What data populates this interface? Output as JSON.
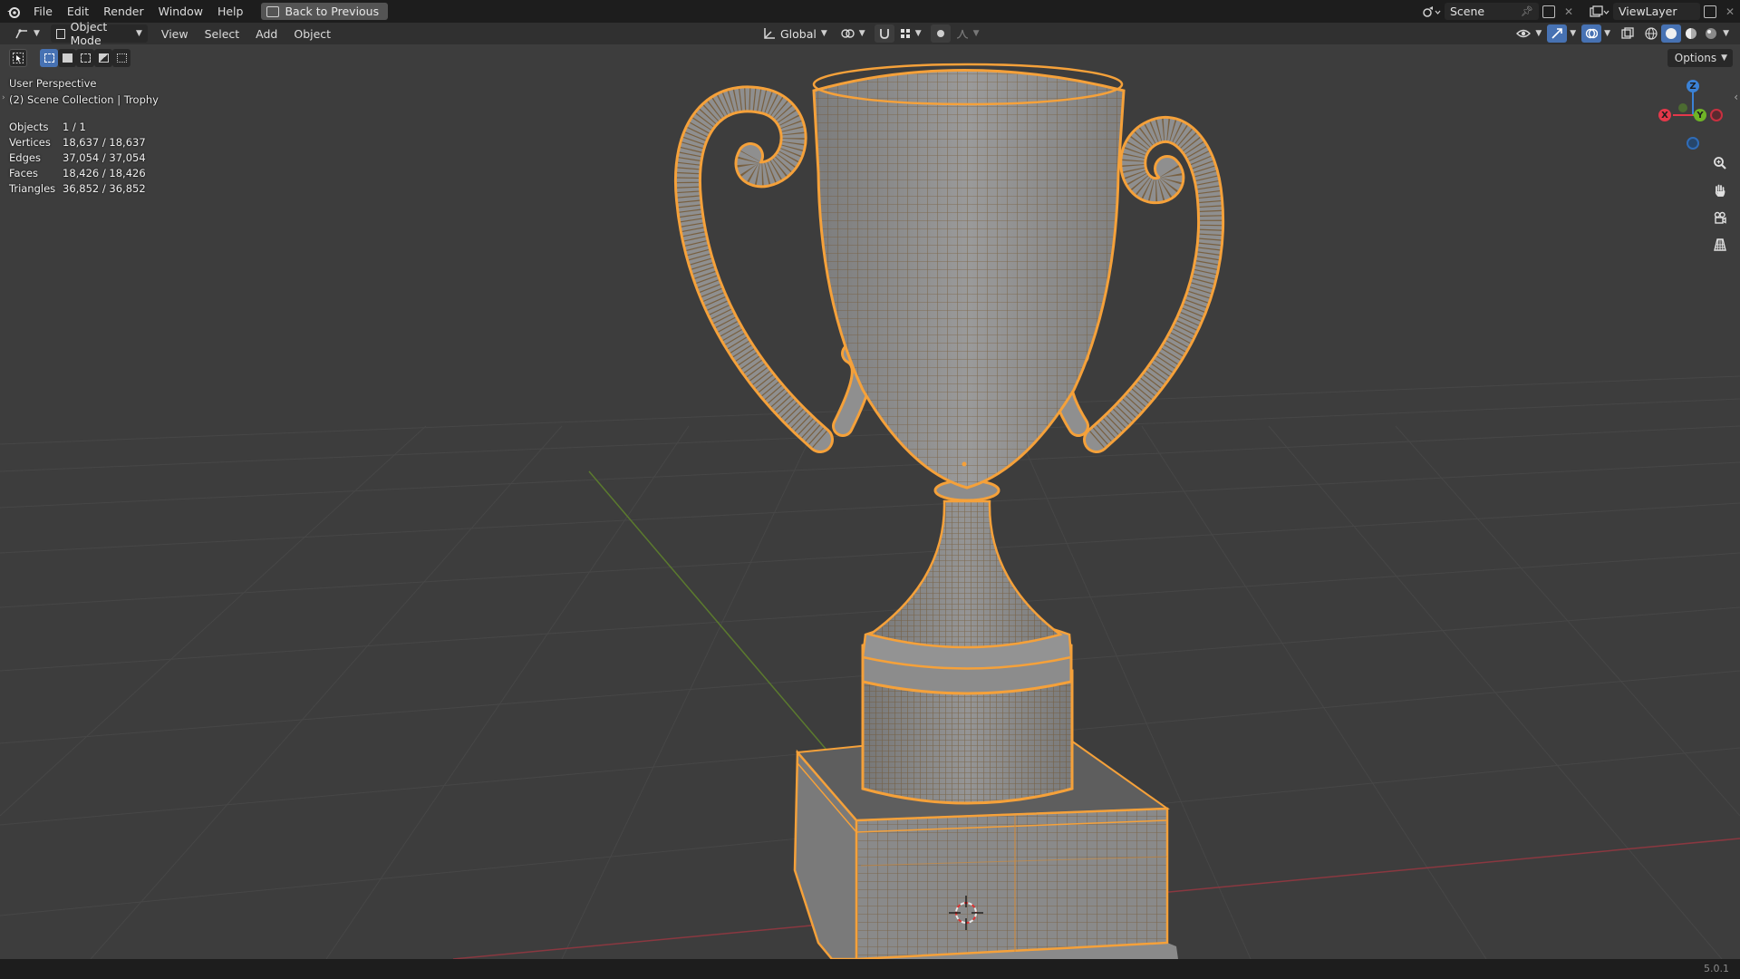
{
  "topbar": {
    "menus": [
      "File",
      "Edit",
      "Render",
      "Window",
      "Help"
    ],
    "back_button": "Back to Previous",
    "scene_value": "Scene",
    "view_layer_value": "ViewLayer"
  },
  "header": {
    "mode": "Object Mode",
    "menus": [
      "View",
      "Select",
      "Add",
      "Object"
    ],
    "orientation": "Global",
    "options_label": "Options"
  },
  "viewport": {
    "perspective": "User Perspective",
    "collection": "(2) Scene Collection | Trophy",
    "stats": [
      {
        "label": "Objects",
        "value": "1 / 1"
      },
      {
        "label": "Vertices",
        "value": "18,637 / 18,637"
      },
      {
        "label": "Edges",
        "value": "37,054 / 37,054"
      },
      {
        "label": "Faces",
        "value": "18,426 / 18,426"
      },
      {
        "label": "Triangles",
        "value": "36,852 / 36,852"
      }
    ],
    "gizmo": {
      "z": "Z",
      "y": "Y",
      "x": "X"
    },
    "colors": {
      "selection": "#f5a13a",
      "x_axis": "#e4384a",
      "y_axis": "#6fb427",
      "z_axis": "#3b82d6",
      "background": "#3d3d3d"
    }
  },
  "status": {
    "version": "5.0.1"
  }
}
